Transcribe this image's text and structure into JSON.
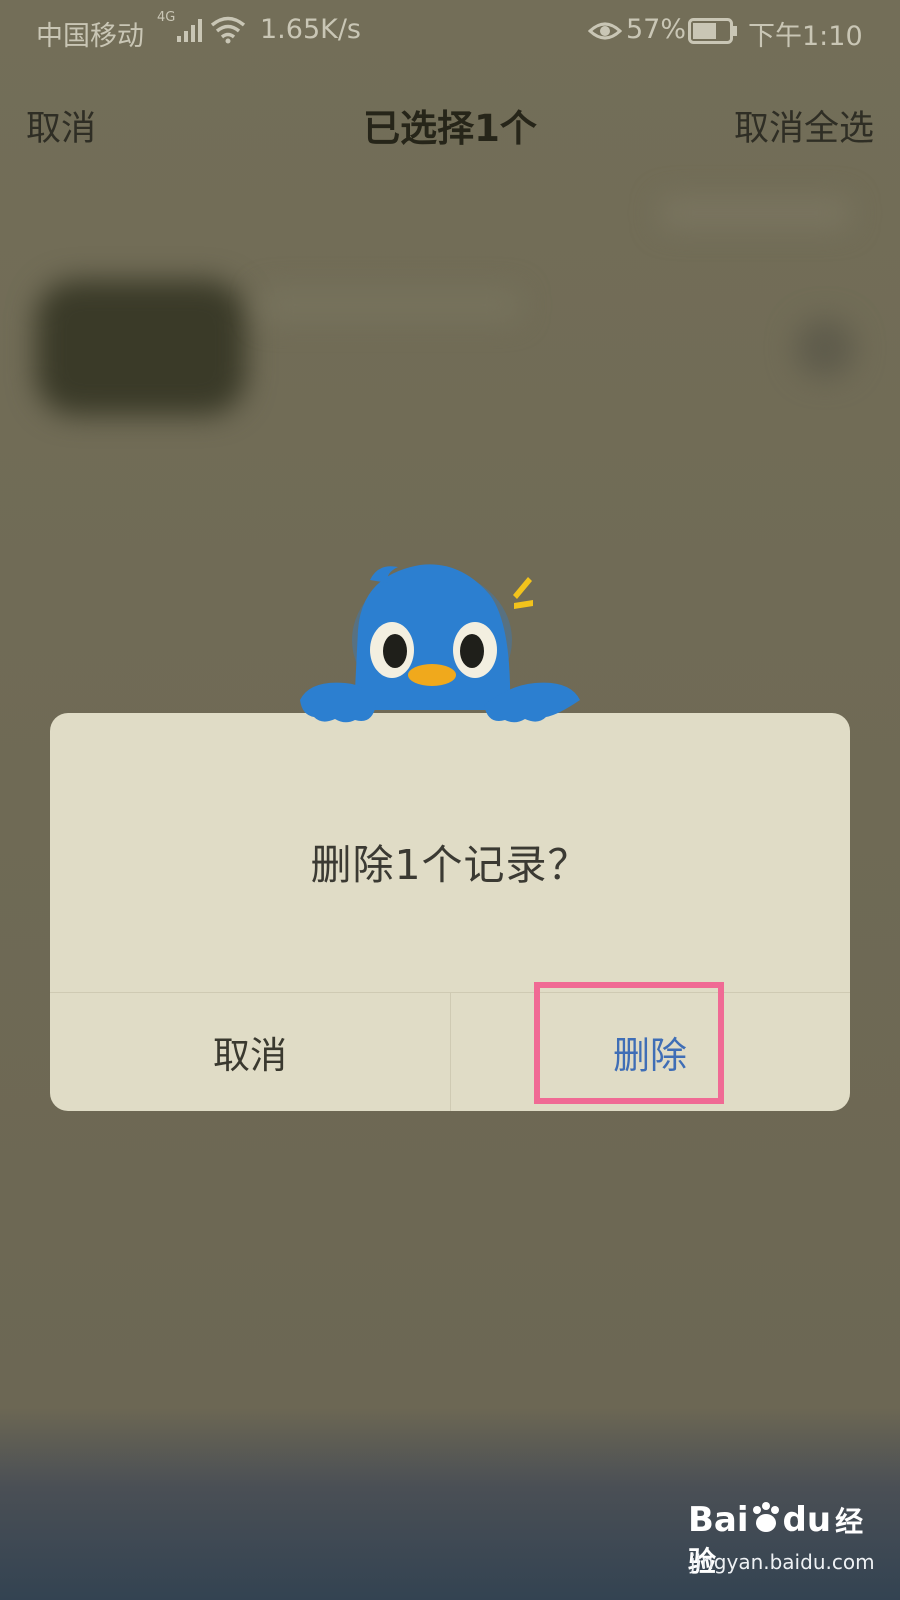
{
  "status_bar": {
    "carrier": "中国移动",
    "network": "4G",
    "speed": "1.65K/s",
    "battery": "57%",
    "time": "下午1:10"
  },
  "nav": {
    "cancel_label": "取消",
    "title": "已选择1个",
    "deselect_all_label": "取消全选"
  },
  "dialog": {
    "message": "删除1个记录？",
    "cancel_label": "取消",
    "delete_label": "删除"
  },
  "watermark": {
    "logo_text": "Bai",
    "logo_suffix": "du",
    "brand_cn": "经验",
    "url": "jingyan.baidu.com"
  },
  "colors": {
    "overlay": "#6d6853",
    "dialog_bg": "#e0dcc6",
    "delete_text": "#3f6eb6",
    "highlight_border": "#f06a94",
    "mascot_blue": "#2c7fd0"
  }
}
